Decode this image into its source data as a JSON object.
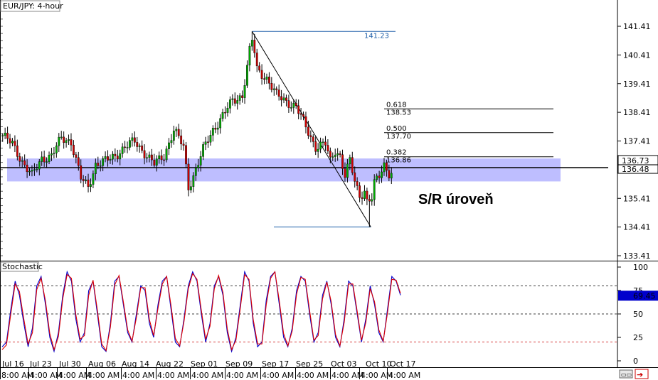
{
  "chart_data": [
    {
      "type": "candlestick",
      "title": "EUR/JPY: 4-hour",
      "ylim": [
        133.0,
        141.8
      ],
      "y_ticks": [
        "141.41",
        "140.41",
        "139.41",
        "138.41",
        "137.41",
        "136.41",
        "135.41",
        "134.41",
        "133.41"
      ],
      "x_ticks": [
        "Jul 16",
        "Jul 23",
        "Jul 30",
        "Aug 06",
        "Aug 14",
        "Aug 22",
        "Sep 01",
        "Sep 09",
        "Sep 17",
        "Sep 25",
        "Oct 03",
        "Oct 10",
        "Oct 17"
      ],
      "x_subticks": [
        "8:00 AM",
        "4:00 AM",
        "4:00 AM",
        "4:00 AM",
        "4:00 AM",
        "4:00 AM",
        "4:00 AM",
        "4:00 AM",
        "4:00 AM",
        "4:00 AM",
        "4:00 AM",
        "4:00 AM",
        "4:00 AM",
        "4:00 AM"
      ],
      "anchors": [
        [
          0,
          137.6
        ],
        [
          4,
          137.3
        ],
        [
          8,
          136.7
        ],
        [
          12,
          136.2
        ],
        [
          16,
          136.8
        ],
        [
          20,
          136.9
        ],
        [
          24,
          137.5
        ],
        [
          28,
          137.4
        ],
        [
          32,
          136.1
        ],
        [
          35,
          135.8
        ],
        [
          38,
          136.6
        ],
        [
          42,
          136.7
        ],
        [
          46,
          136.9
        ],
        [
          50,
          137.2
        ],
        [
          54,
          137.4
        ],
        [
          58,
          137.0
        ],
        [
          62,
          136.6
        ],
        [
          66,
          136.9
        ],
        [
          70,
          137.8
        ],
        [
          74,
          137.2
        ],
        [
          76,
          135.8
        ],
        [
          78,
          136.2
        ],
        [
          82,
          137.1
        ],
        [
          86,
          137.8
        ],
        [
          90,
          138.3
        ],
        [
          94,
          138.8
        ],
        [
          98,
          139.0
        ],
        [
          100,
          140.0
        ],
        [
          102,
          141.1
        ],
        [
          104,
          139.9
        ],
        [
          108,
          139.6
        ],
        [
          112,
          139.0
        ],
        [
          116,
          138.8
        ],
        [
          120,
          138.6
        ],
        [
          124,
          137.9
        ],
        [
          128,
          137.2
        ],
        [
          132,
          137.3
        ],
        [
          134,
          136.7
        ],
        [
          136,
          137.1
        ],
        [
          138,
          136.9
        ],
        [
          140,
          136.2
        ],
        [
          142,
          136.7
        ],
        [
          144,
          136.0
        ],
        [
          146,
          135.5
        ],
        [
          148,
          135.7
        ],
        [
          150,
          134.9
        ],
        [
          152,
          135.9
        ],
        [
          154,
          136.2
        ],
        [
          156,
          136.6
        ],
        [
          158,
          136.3
        ]
      ],
      "high": 141.23,
      "low": 134.41,
      "fib_levels": [
        {
          "ratio": "0.618",
          "value": "138.53"
        },
        {
          "ratio": "0.500",
          "value": "137.70"
        },
        {
          "ratio": "0.382",
          "value": "136.86"
        }
      ],
      "current_price": "136.48",
      "zone_top_price": "136.73",
      "sr_band": [
        136.0,
        136.8
      ],
      "sr_line": 136.48,
      "colors": {
        "bull": "#00aa00",
        "bear": "#cc0000",
        "band": "#b3b3ff",
        "fib": "#1f5fa8",
        "sr_line": "#000000"
      }
    },
    {
      "type": "line",
      "title": "Stochastic",
      "ylim": [
        0,
        100
      ],
      "y_ticks": [
        "100",
        "75",
        "50",
        "25",
        "0"
      ],
      "current_value": "69.45",
      "levels": [
        80,
        50,
        20
      ],
      "series": [
        {
          "color": "#0000cc",
          "values": [
            15,
            20,
            55,
            85,
            70,
            40,
            15,
            35,
            80,
            90,
            60,
            25,
            10,
            30,
            70,
            95,
            85,
            45,
            20,
            30,
            75,
            85,
            50,
            15,
            10,
            40,
            85,
            90,
            60,
            30,
            20,
            50,
            80,
            75,
            40,
            25,
            60,
            85,
            90,
            55,
            20,
            15,
            45,
            80,
            95,
            85,
            50,
            20,
            40,
            80,
            90,
            70,
            30,
            10,
            25,
            60,
            95,
            85,
            40,
            15,
            20,
            65,
            90,
            95,
            60,
            25,
            15,
            35,
            75,
            90,
            85,
            50,
            20,
            30,
            70,
            85,
            60,
            25,
            15,
            45,
            85,
            80,
            50,
            20,
            45,
            80,
            60,
            30,
            20,
            55,
            90,
            85,
            70
          ]
        },
        {
          "color": "#dd0000",
          "values": [
            12,
            17,
            50,
            82,
            74,
            45,
            18,
            30,
            76,
            88,
            64,
            29,
            12,
            26,
            66,
            92,
            88,
            50,
            23,
            27,
            70,
            86,
            54,
            18,
            11,
            36,
            81,
            91,
            63,
            33,
            21,
            46,
            78,
            78,
            44,
            27,
            56,
            82,
            90,
            59,
            24,
            16,
            42,
            77,
            93,
            87,
            54,
            23,
            37,
            77,
            91,
            73,
            34,
            12,
            22,
            56,
            92,
            87,
            44,
            18,
            18,
            60,
            88,
            95,
            64,
            29,
            16,
            32,
            71,
            89,
            87,
            54,
            22,
            27,
            66,
            84,
            63,
            28,
            16,
            41,
            82,
            82,
            53,
            22,
            41,
            77,
            63,
            33,
            21,
            51,
            87,
            86,
            72
          ]
        }
      ]
    }
  ],
  "annotations": {
    "sr_label": "S/R úroveň"
  },
  "labels": {
    "title": "EUR/JPY: 4-hour",
    "stoch_title": "Stochastic"
  }
}
